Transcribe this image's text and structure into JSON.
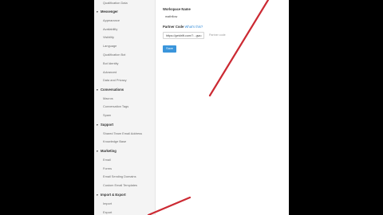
{
  "sidebar": {
    "top_items": [
      "Qualification Data"
    ],
    "sections": [
      {
        "title": "Messenger",
        "items": [
          "Appearance",
          "Availability",
          "Visibility",
          "Language",
          "Qualification Bot",
          "Bot Identity",
          "Advanced",
          "Data and Privacy"
        ]
      },
      {
        "title": "Conversations",
        "items": [
          "Macros",
          "Conversation Tags",
          "Spam"
        ]
      },
      {
        "title": "Support",
        "items": [
          "Shared Team Email Address",
          "Knowledge Base"
        ]
      },
      {
        "title": "Marketing",
        "items": [
          "Email",
          "Forms",
          "Email Sending Domains",
          "Custom Email Templates"
        ]
      },
      {
        "title": "Import & Export",
        "items": [
          "Import",
          "Export"
        ]
      }
    ]
  },
  "form": {
    "workspace_label": "Workspace Name",
    "workspace_value": "mathflow",
    "partner_label": "Partner Code",
    "partner_link": "What's this?",
    "partner_value": "https://getdrift.com/?...gwu",
    "partner_hint": "Partner code",
    "save_label": "Save"
  },
  "colors": {
    "accent": "#3a95db",
    "annotation": "#cc2a33"
  }
}
